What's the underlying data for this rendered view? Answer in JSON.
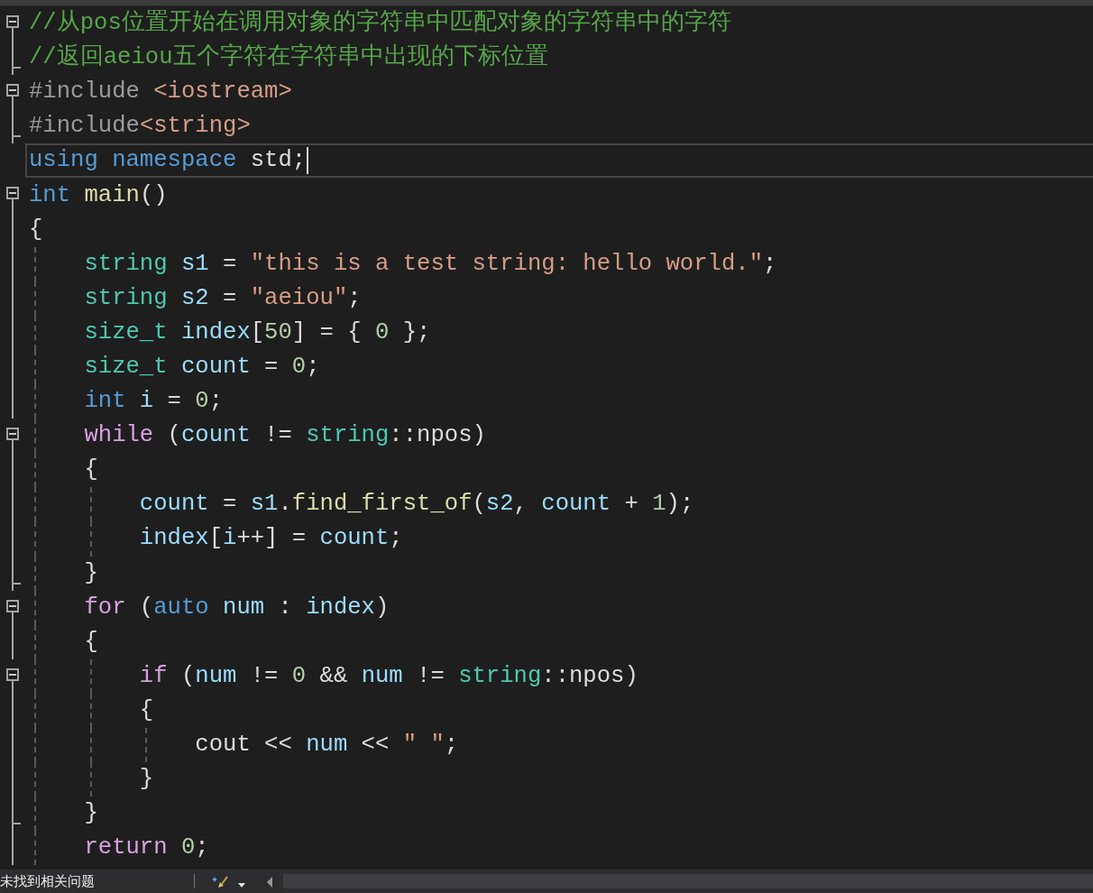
{
  "editor": {
    "lines": [
      {
        "collapsible": true,
        "block_end": false,
        "in_block": true,
        "current": false,
        "tokens": [
          {
            "kind": "comment",
            "text": "//从pos位置开始在调用对象的字符串中匹配对象的字符串中的字符"
          }
        ]
      },
      {
        "collapsible": false,
        "block_end": true,
        "in_block": true,
        "current": false,
        "tokens": [
          {
            "kind": "comment",
            "text": "//返回aeiou五个字符在字符串中出现的下标位置"
          }
        ]
      },
      {
        "collapsible": true,
        "block_end": false,
        "in_block": true,
        "current": false,
        "tokens": [
          {
            "kind": "preproc",
            "text": "#include "
          },
          {
            "kind": "string",
            "text": "<iostream>"
          }
        ]
      },
      {
        "collapsible": false,
        "block_end": true,
        "in_block": true,
        "current": false,
        "tokens": [
          {
            "kind": "preproc",
            "text": "#include"
          },
          {
            "kind": "string",
            "text": "<string>"
          }
        ]
      },
      {
        "collapsible": false,
        "block_end": false,
        "in_block": false,
        "current": true,
        "tokens": [
          {
            "kind": "keyword",
            "text": "using"
          },
          {
            "kind": "keyword",
            "text": " namespace"
          },
          {
            "kind": "plain",
            "text": " std;"
          }
        ]
      },
      {
        "collapsible": true,
        "block_end": false,
        "in_block": true,
        "current": false,
        "tokens": [
          {
            "kind": "keyword",
            "text": "int"
          },
          {
            "kind": "function",
            "text": " main"
          },
          {
            "kind": "plain",
            "text": "()"
          }
        ]
      },
      {
        "collapsible": false,
        "block_end": false,
        "in_block": true,
        "current": false,
        "tokens": [
          {
            "kind": "plain",
            "text": "{"
          }
        ]
      },
      {
        "collapsible": false,
        "block_end": false,
        "in_block": true,
        "current": false,
        "tokens": [
          {
            "kind": "type",
            "text": "    string"
          },
          {
            "kind": "variable",
            "text": " s1"
          },
          {
            "kind": "plain",
            "text": " = "
          },
          {
            "kind": "string",
            "text": "\"this is a test string: hello world.\""
          },
          {
            "kind": "plain",
            "text": ";"
          }
        ]
      },
      {
        "collapsible": false,
        "block_end": false,
        "in_block": true,
        "current": false,
        "tokens": [
          {
            "kind": "type",
            "text": "    string"
          },
          {
            "kind": "variable",
            "text": " s2"
          },
          {
            "kind": "plain",
            "text": " = "
          },
          {
            "kind": "string",
            "text": "\"aeiou\""
          },
          {
            "kind": "plain",
            "text": ";"
          }
        ]
      },
      {
        "collapsible": false,
        "block_end": false,
        "in_block": true,
        "current": false,
        "tokens": [
          {
            "kind": "type",
            "text": "    size_t"
          },
          {
            "kind": "variable",
            "text": " index"
          },
          {
            "kind": "plain",
            "text": "["
          },
          {
            "kind": "number",
            "text": "50"
          },
          {
            "kind": "plain",
            "text": "] = { "
          },
          {
            "kind": "number",
            "text": "0"
          },
          {
            "kind": "plain",
            "text": " };"
          }
        ]
      },
      {
        "collapsible": false,
        "block_end": false,
        "in_block": true,
        "current": false,
        "tokens": [
          {
            "kind": "type",
            "text": "    size_t"
          },
          {
            "kind": "variable",
            "text": " count"
          },
          {
            "kind": "plain",
            "text": " = "
          },
          {
            "kind": "number",
            "text": "0"
          },
          {
            "kind": "plain",
            "text": ";"
          }
        ]
      },
      {
        "collapsible": false,
        "block_end": false,
        "in_block": true,
        "current": false,
        "tokens": [
          {
            "kind": "keyword",
            "text": "    int"
          },
          {
            "kind": "variable",
            "text": " i"
          },
          {
            "kind": "plain",
            "text": " = "
          },
          {
            "kind": "number",
            "text": "0"
          },
          {
            "kind": "plain",
            "text": ";"
          }
        ]
      },
      {
        "collapsible": true,
        "block_end": false,
        "in_block": true,
        "current": false,
        "tokens": [
          {
            "kind": "control",
            "text": "    while"
          },
          {
            "kind": "plain",
            "text": " ("
          },
          {
            "kind": "variable",
            "text": "count"
          },
          {
            "kind": "plain",
            "text": " != "
          },
          {
            "kind": "type",
            "text": "string"
          },
          {
            "kind": "plain",
            "text": "::npos)"
          }
        ]
      },
      {
        "collapsible": false,
        "block_end": false,
        "in_block": true,
        "current": false,
        "tokens": [
          {
            "kind": "plain",
            "text": "    {"
          }
        ]
      },
      {
        "collapsible": false,
        "block_end": false,
        "in_block": true,
        "current": false,
        "tokens": [
          {
            "kind": "variable",
            "text": "        count"
          },
          {
            "kind": "plain",
            "text": " = "
          },
          {
            "kind": "variable",
            "text": "s1"
          },
          {
            "kind": "plain",
            "text": "."
          },
          {
            "kind": "function",
            "text": "find_first_of"
          },
          {
            "kind": "plain",
            "text": "("
          },
          {
            "kind": "variable",
            "text": "s2"
          },
          {
            "kind": "plain",
            "text": ", "
          },
          {
            "kind": "variable",
            "text": "count"
          },
          {
            "kind": "plain",
            "text": " + "
          },
          {
            "kind": "number",
            "text": "1"
          },
          {
            "kind": "plain",
            "text": ");"
          }
        ]
      },
      {
        "collapsible": false,
        "block_end": false,
        "in_block": true,
        "current": false,
        "tokens": [
          {
            "kind": "variable",
            "text": "        index"
          },
          {
            "kind": "plain",
            "text": "["
          },
          {
            "kind": "variable",
            "text": "i"
          },
          {
            "kind": "plain",
            "text": "++] = "
          },
          {
            "kind": "variable",
            "text": "count"
          },
          {
            "kind": "plain",
            "text": ";"
          }
        ]
      },
      {
        "collapsible": false,
        "block_end": true,
        "in_block": true,
        "current": false,
        "tokens": [
          {
            "kind": "plain",
            "text": "    }"
          }
        ]
      },
      {
        "collapsible": true,
        "block_end": false,
        "in_block": true,
        "current": false,
        "tokens": [
          {
            "kind": "control",
            "text": "    for"
          },
          {
            "kind": "plain",
            "text": " ("
          },
          {
            "kind": "keyword",
            "text": "auto"
          },
          {
            "kind": "variable",
            "text": " num"
          },
          {
            "kind": "plain",
            "text": " : "
          },
          {
            "kind": "variable",
            "text": "index"
          },
          {
            "kind": "plain",
            "text": ")"
          }
        ]
      },
      {
        "collapsible": false,
        "block_end": false,
        "in_block": true,
        "current": false,
        "tokens": [
          {
            "kind": "plain",
            "text": "    {"
          }
        ]
      },
      {
        "collapsible": true,
        "block_end": false,
        "in_block": true,
        "current": false,
        "tokens": [
          {
            "kind": "control",
            "text": "        if"
          },
          {
            "kind": "plain",
            "text": " ("
          },
          {
            "kind": "variable",
            "text": "num"
          },
          {
            "kind": "plain",
            "text": " != "
          },
          {
            "kind": "number",
            "text": "0"
          },
          {
            "kind": "plain",
            "text": " && "
          },
          {
            "kind": "variable",
            "text": "num"
          },
          {
            "kind": "plain",
            "text": " != "
          },
          {
            "kind": "type",
            "text": "string"
          },
          {
            "kind": "plain",
            "text": "::npos)"
          }
        ]
      },
      {
        "collapsible": false,
        "block_end": false,
        "in_block": true,
        "current": false,
        "tokens": [
          {
            "kind": "plain",
            "text": "        {"
          }
        ]
      },
      {
        "collapsible": false,
        "block_end": false,
        "in_block": true,
        "current": false,
        "tokens": [
          {
            "kind": "plain",
            "text": "            cout << "
          },
          {
            "kind": "variable",
            "text": "num"
          },
          {
            "kind": "plain",
            "text": " << "
          },
          {
            "kind": "string",
            "text": "\" \""
          },
          {
            "kind": "plain",
            "text": ";"
          }
        ]
      },
      {
        "collapsible": false,
        "block_end": false,
        "in_block": true,
        "current": false,
        "tokens": [
          {
            "kind": "plain",
            "text": "        }"
          }
        ]
      },
      {
        "collapsible": false,
        "block_end": true,
        "in_block": true,
        "current": false,
        "tokens": [
          {
            "kind": "plain",
            "text": "    }"
          }
        ]
      },
      {
        "collapsible": false,
        "block_end": false,
        "in_block": true,
        "current": false,
        "tokens": [
          {
            "kind": "control",
            "text": "    return"
          },
          {
            "kind": "number",
            "text": " 0"
          },
          {
            "kind": "plain",
            "text": ";"
          }
        ]
      }
    ]
  },
  "status_bar": {
    "message": "未找到相关问题"
  }
}
